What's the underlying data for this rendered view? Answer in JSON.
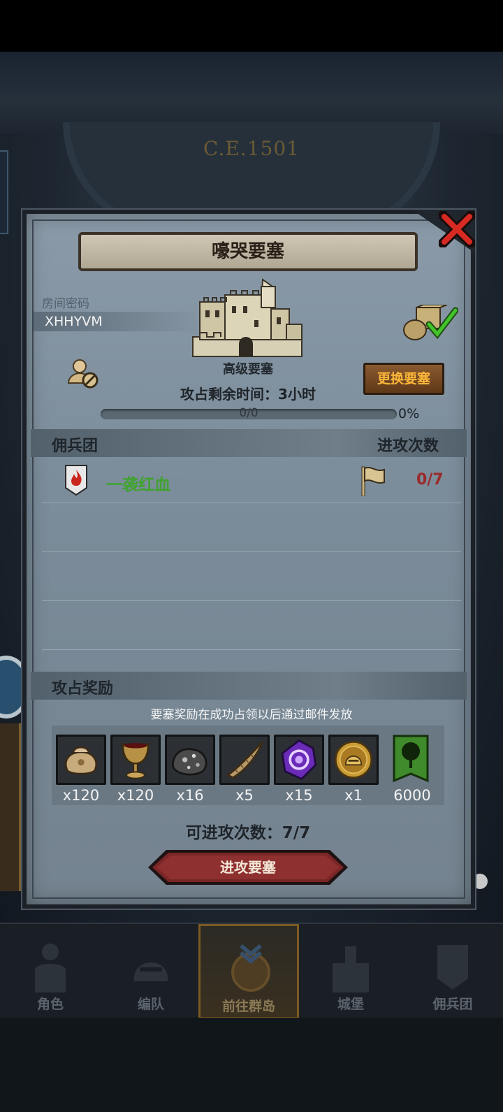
{
  "background": {
    "year_label": "C.E.1501"
  },
  "dialog": {
    "title": "嚎哭要塞",
    "room": {
      "label": "房间密码",
      "code": "XHHYVM"
    },
    "fortress": {
      "name": "高级要塞",
      "occupy_time": "攻占剩余时间：3小时",
      "change_button": "更换要塞"
    },
    "progress": {
      "text": "0/0",
      "percent_label": "0%",
      "fraction": 0
    },
    "mercenary_section": {
      "title": "佣兵团",
      "attack_count_header": "进攻次数",
      "rows": [
        {
          "name": "一袭红血",
          "count": "0/7"
        }
      ]
    },
    "rewards": {
      "title": "攻占奖励",
      "note": "要塞奖励在成功占领以后通过邮件发放",
      "items": [
        {
          "icon": "sack-icon",
          "qty": "x120"
        },
        {
          "icon": "goblet-icon",
          "qty": "x120"
        },
        {
          "icon": "ore-icon",
          "qty": "x16"
        },
        {
          "icon": "horn-icon",
          "qty": "x5"
        },
        {
          "icon": "purple-gem-icon",
          "qty": "x15"
        },
        {
          "icon": "gold-coin-helmet-icon",
          "qty": "x1"
        },
        {
          "icon": "tree-banner-icon",
          "qty": "6000"
        }
      ]
    },
    "attacks_left": "可进攻次数：7/7",
    "attack_button": "进攻要塞"
  },
  "nav": {
    "items": [
      {
        "label": "角色"
      },
      {
        "label": "编队"
      },
      {
        "label": "前往群岛"
      },
      {
        "label": "城堡"
      },
      {
        "label": "佣兵团"
      }
    ],
    "active_index": 2
  },
  "colors": {
    "accent_gold": "#ffb83a",
    "merc_name_green": "#3fa32f",
    "count_red": "#9a2b2b",
    "attack_button_red": "#7a2626"
  }
}
